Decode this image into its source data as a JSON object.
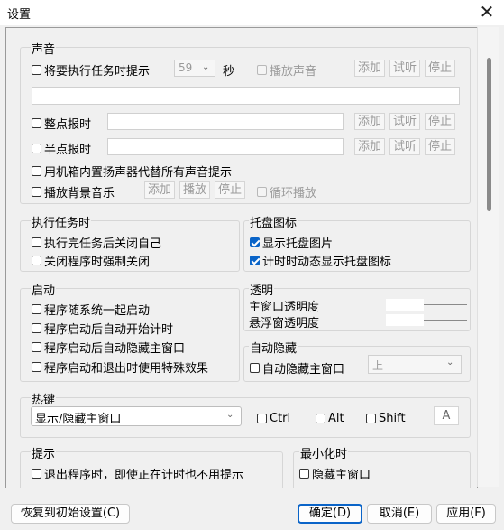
{
  "window": {
    "title": "设置",
    "close_glyph": "✕"
  },
  "sound": {
    "group_label": "声音",
    "remind_label": "将要执行任务时提示",
    "remind_seconds": "59",
    "seconds_unit": "秒",
    "play_sound_label": "播放声音",
    "add": "添加",
    "listen": "试听",
    "stop": "停止",
    "hourly_label": "整点报时",
    "half_hour_label": "半点报时",
    "speaker_label": "用机箱内置扬声器代替所有声音提示",
    "bgm_label": "播放背景音乐",
    "play": "播放",
    "loop_label": "循环播放"
  },
  "execute": {
    "group_label": "执行任务时",
    "close_self_label": "执行完任务后关闭自己",
    "force_close_label": "关闭程序时强制关闭"
  },
  "tray": {
    "group_label": "托盘图标",
    "show_icon_label": "显示托盘图片",
    "dynamic_icon_label": "计时时动态显示托盘图标"
  },
  "startup": {
    "group_label": "启动",
    "auto_start_label": "程序随系统一起启动",
    "auto_timer_label": "程序启动后自动开始计时",
    "hide_main_label": "程序启动后自动隐藏主窗口",
    "effects_label": "程序启动和退出时使用特殊效果"
  },
  "transparency": {
    "group_label": "透明",
    "main_label": "主窗口透明度",
    "float_label": "悬浮窗透明度"
  },
  "autohide": {
    "group_label": "自动隐藏",
    "hide_label": "自动隐藏主窗口",
    "direction": "上"
  },
  "hotkey": {
    "group_label": "热键",
    "action": "显示/隐藏主窗口",
    "ctrl": "Ctrl",
    "alt": "Alt",
    "shift": "Shift",
    "key": "A"
  },
  "prompt": {
    "group_label": "提示",
    "exit_label": "退出程序时，即使正在计时也不用提示"
  },
  "minimize": {
    "group_label": "最小化时",
    "hide_label": "隐藏主窗口"
  },
  "footer": {
    "reset": "恢复到初始设置(C)",
    "ok": "确定(D)",
    "cancel": "取消(E)",
    "apply": "应用(F)"
  },
  "states": {
    "remind": false,
    "play_sound": false,
    "hourly": false,
    "half_hour": false,
    "speaker": false,
    "bgm": false,
    "loop": false,
    "close_self": false,
    "force_close": false,
    "show_tray": true,
    "dynamic_tray": true,
    "auto_start": false,
    "auto_timer": false,
    "hide_main": false,
    "effects": false,
    "autohide": false,
    "ctrl": false,
    "alt": false,
    "shift": false,
    "exit_prompt": false,
    "min_hide": false
  },
  "colors": {
    "accent": "#0a64c8",
    "window_bg": "#f0f0f0",
    "disabled_text": "#9a9a9a"
  }
}
